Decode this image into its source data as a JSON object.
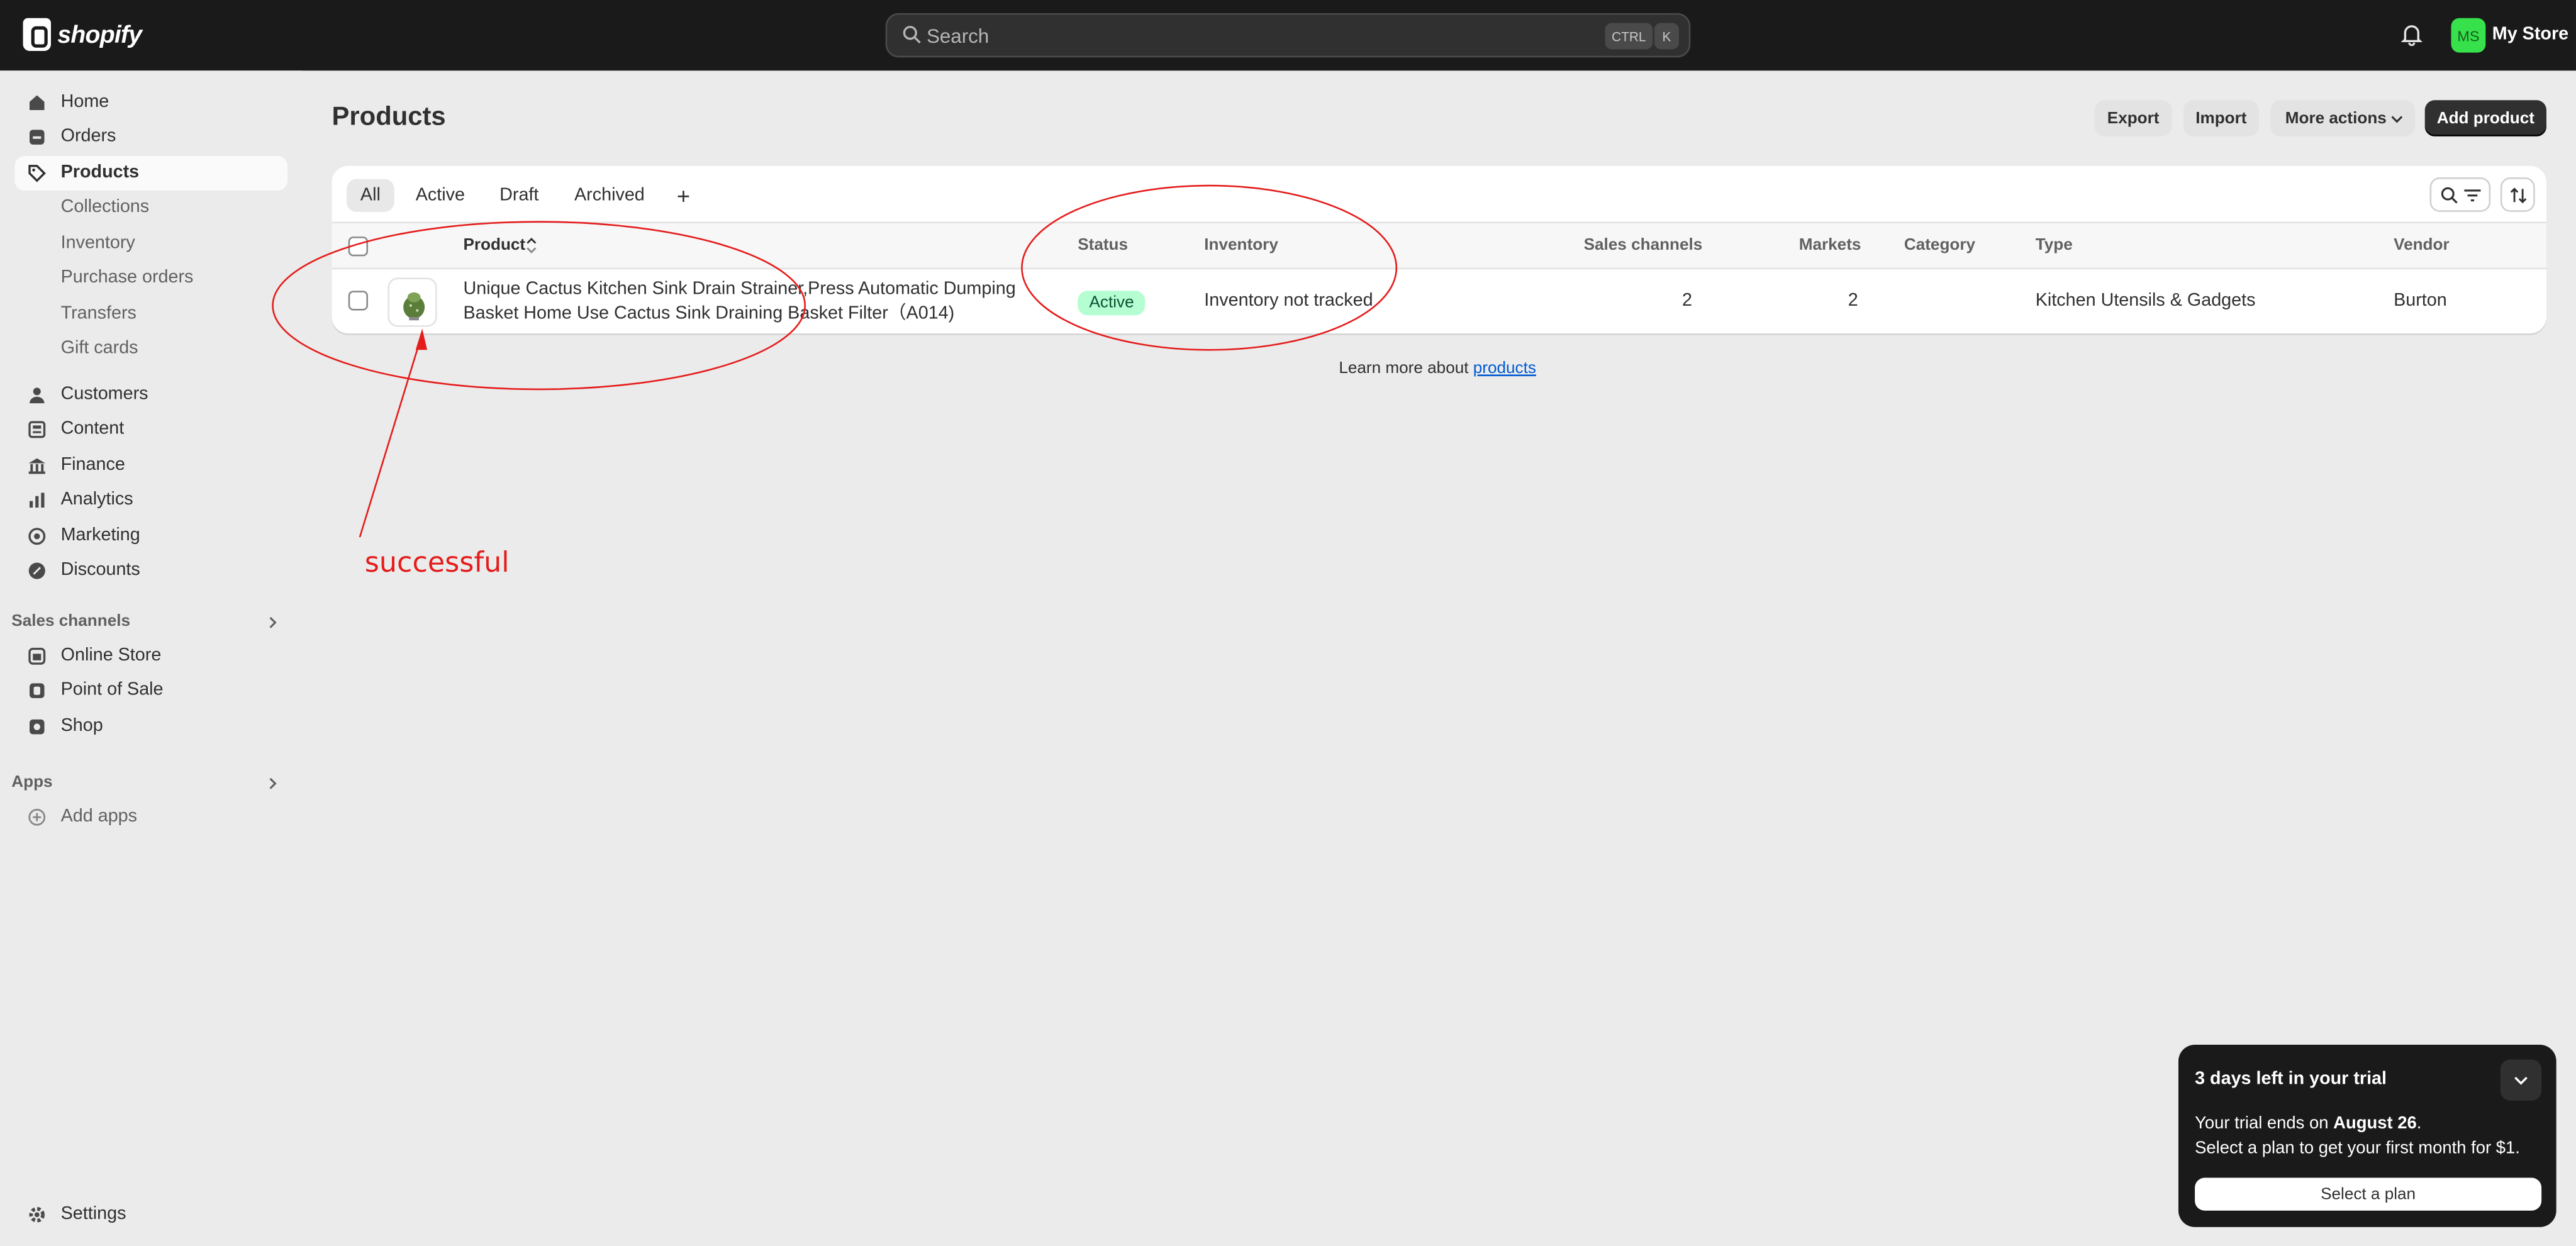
{
  "topbar": {
    "brand": "shopify",
    "search_placeholder": "Search",
    "shortcut_1": "CTRL",
    "shortcut_2": "K",
    "avatar_initials": "MS",
    "store_name": "My Store"
  },
  "sidebar": {
    "items": [
      {
        "label": "Home",
        "icon": "home-icon"
      },
      {
        "label": "Orders",
        "icon": "inbox-icon"
      },
      {
        "label": "Products",
        "icon": "tag-icon"
      },
      {
        "label": "Collections"
      },
      {
        "label": "Inventory"
      },
      {
        "label": "Purchase orders"
      },
      {
        "label": "Transfers"
      },
      {
        "label": "Gift cards"
      },
      {
        "label": "Customers",
        "icon": "person-icon"
      },
      {
        "label": "Content",
        "icon": "content-icon"
      },
      {
        "label": "Finance",
        "icon": "bank-icon"
      },
      {
        "label": "Analytics",
        "icon": "chart-icon"
      },
      {
        "label": "Marketing",
        "icon": "target-icon"
      },
      {
        "label": "Discounts",
        "icon": "discount-icon"
      }
    ],
    "sales_channels_heading": "Sales channels",
    "channels": [
      {
        "label": "Online Store",
        "icon": "store-icon"
      },
      {
        "label": "Point of Sale",
        "icon": "pos-icon"
      },
      {
        "label": "Shop",
        "icon": "shop-icon"
      }
    ],
    "apps_heading": "Apps",
    "add_apps": "Add apps",
    "settings": "Settings"
  },
  "page": {
    "title": "Products",
    "export": "Export",
    "import": "Import",
    "more_actions": "More actions",
    "add_product": "Add product"
  },
  "tabs": [
    "All",
    "Active",
    "Draft",
    "Archived",
    "+"
  ],
  "table": {
    "headers": [
      "Product",
      "Status",
      "Inventory",
      "Sales channels",
      "Markets",
      "Category",
      "Type",
      "Vendor"
    ],
    "rows": [
      {
        "product_line1": "Unique Cactus Kitchen Sink Drain Strainer,Press Automatic Dumping",
        "product_line2": "Basket Home Use Cactus Sink Draining Basket Filter（A014)",
        "status": "Active",
        "inventory": "Inventory not tracked",
        "sales_channels": "2",
        "markets": "2",
        "category": "",
        "type": "Kitchen Utensils & Gadgets",
        "vendor": "Burton"
      }
    ]
  },
  "learn_more": {
    "prefix": "Learn more about ",
    "link": "products"
  },
  "annotation": {
    "text": "successful",
    "color": "#e51c1c"
  },
  "trial": {
    "title": "3 days left in your trial",
    "line1_prefix": "Your trial ends on ",
    "line1_date": "August 26",
    "line1_suffix": ".",
    "line2": "Select a plan to get your first month for $1.",
    "button": "Select a plan"
  },
  "colors": {
    "topbar_bg": "#1a1a1a",
    "active_badge_bg": "#b4fed2",
    "primary_button": "#303030",
    "avatar_bg": "#36e14c",
    "link": "#005bd3"
  }
}
